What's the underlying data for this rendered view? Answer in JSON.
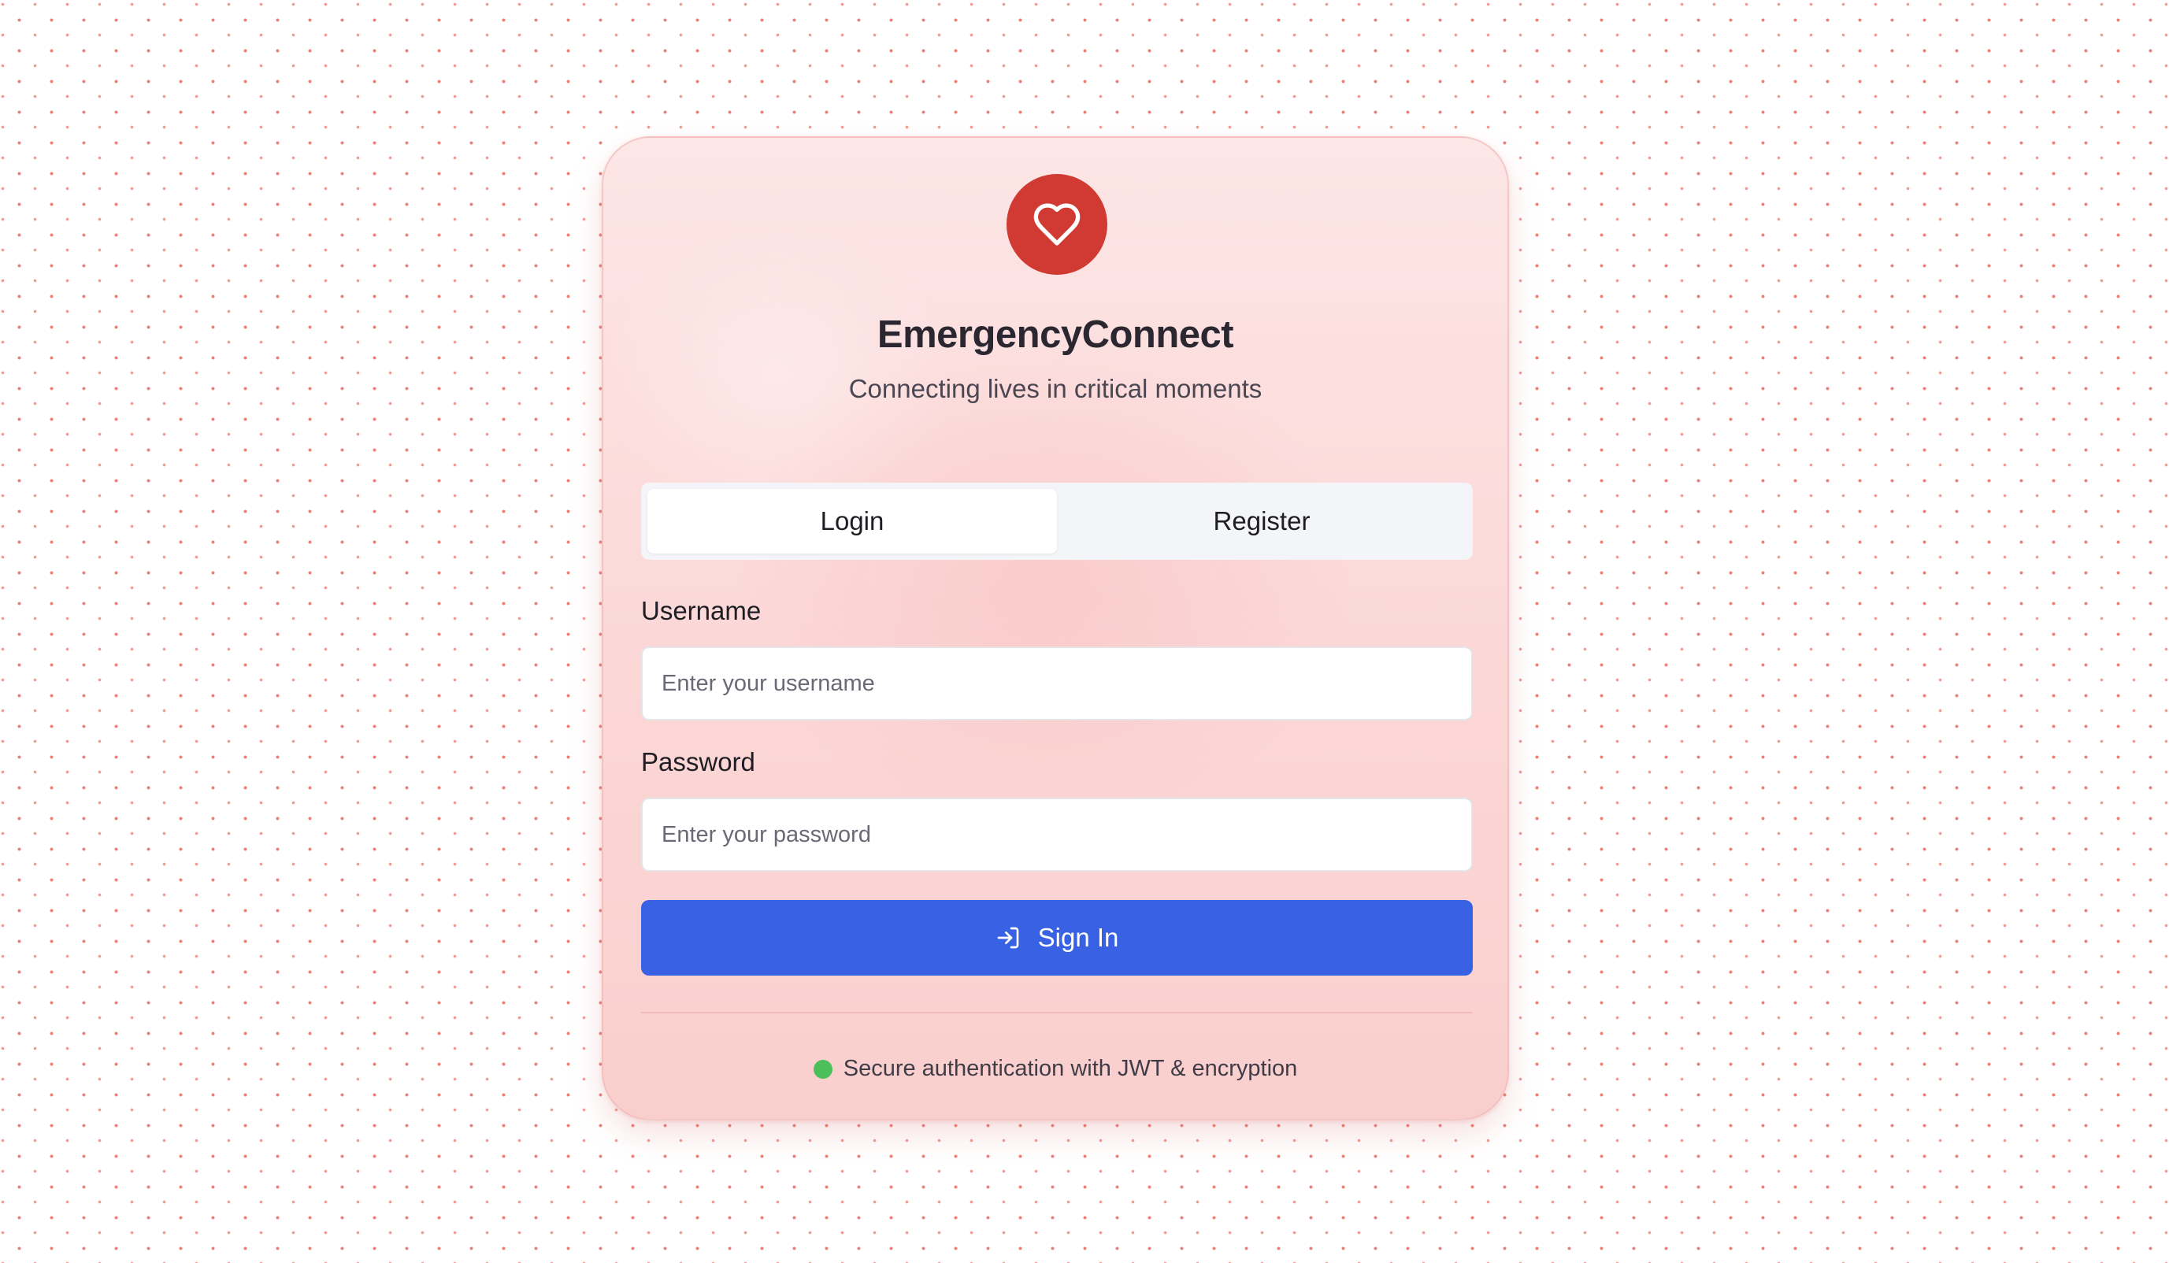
{
  "app": {
    "title": "EmergencyConnect",
    "subtitle": "Connecting lives in critical moments",
    "logo_icon": "heart-icon"
  },
  "tabs": [
    {
      "label": "Login",
      "active": true
    },
    {
      "label": "Register",
      "active": false
    }
  ],
  "form": {
    "username": {
      "label": "Username",
      "placeholder": "Enter your username",
      "value": ""
    },
    "password": {
      "label": "Password",
      "placeholder": "Enter your password",
      "value": ""
    },
    "submit_label": "Sign In",
    "submit_icon": "log-in-icon"
  },
  "footer": {
    "secure_text": "Secure authentication with JWT & encryption",
    "status_icon": "status-dot-icon"
  },
  "colors": {
    "brand_red": "#d13a32",
    "primary_blue": "#3862e3",
    "status_green": "#4cbf5a",
    "card_pink": "#fbd7d6"
  }
}
